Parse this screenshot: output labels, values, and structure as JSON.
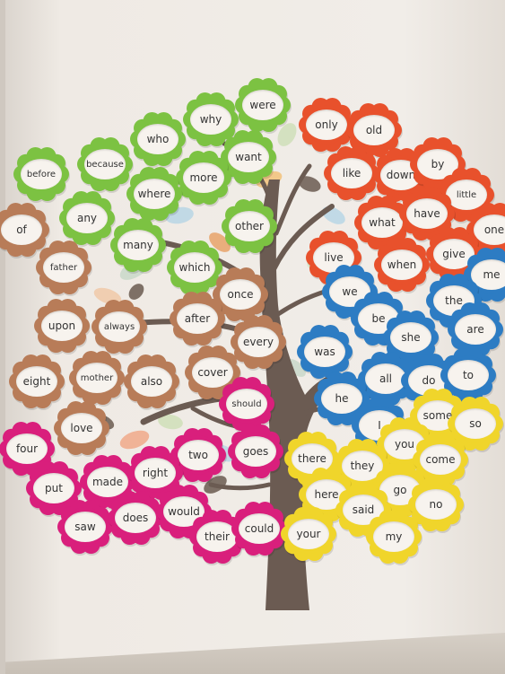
{
  "colors": {
    "green": "#7cc242",
    "orange": "#e8512c",
    "brown": "#b87c58",
    "blue": "#2d7cc3",
    "pink": "#d91f7c",
    "yellow": "#f0d52b",
    "trunk": "#6b5b52",
    "wall": "#ece7e1"
  },
  "flowers": [
    {
      "word": "were",
      "color": "green"
    },
    {
      "word": "why",
      "color": "green"
    },
    {
      "word": "who",
      "color": "green"
    },
    {
      "word": "because",
      "color": "green"
    },
    {
      "word": "before",
      "color": "green"
    },
    {
      "word": "want",
      "color": "green"
    },
    {
      "word": "more",
      "color": "green"
    },
    {
      "word": "where",
      "color": "green"
    },
    {
      "word": "any",
      "color": "green"
    },
    {
      "word": "other",
      "color": "green"
    },
    {
      "word": "many",
      "color": "green"
    },
    {
      "word": "which",
      "color": "green"
    },
    {
      "word": "only",
      "color": "orange"
    },
    {
      "word": "old",
      "color": "orange"
    },
    {
      "word": "like",
      "color": "orange"
    },
    {
      "word": "down",
      "color": "orange"
    },
    {
      "word": "by",
      "color": "orange"
    },
    {
      "word": "little",
      "color": "orange"
    },
    {
      "word": "what",
      "color": "orange"
    },
    {
      "word": "have",
      "color": "orange"
    },
    {
      "word": "one",
      "color": "orange"
    },
    {
      "word": "live",
      "color": "orange"
    },
    {
      "word": "when",
      "color": "orange"
    },
    {
      "word": "give",
      "color": "orange"
    },
    {
      "word": "of",
      "color": "brown"
    },
    {
      "word": "father",
      "color": "brown"
    },
    {
      "word": "once",
      "color": "brown"
    },
    {
      "word": "upon",
      "color": "brown"
    },
    {
      "word": "always",
      "color": "brown"
    },
    {
      "word": "after",
      "color": "brown"
    },
    {
      "word": "every",
      "color": "brown"
    },
    {
      "word": "eight",
      "color": "brown"
    },
    {
      "word": "mother",
      "color": "brown"
    },
    {
      "word": "also",
      "color": "brown"
    },
    {
      "word": "cover",
      "color": "brown"
    },
    {
      "word": "love",
      "color": "brown"
    },
    {
      "word": "me",
      "color": "blue"
    },
    {
      "word": "we",
      "color": "blue"
    },
    {
      "word": "the",
      "color": "blue"
    },
    {
      "word": "be",
      "color": "blue"
    },
    {
      "word": "are",
      "color": "blue"
    },
    {
      "word": "she",
      "color": "blue"
    },
    {
      "word": "was",
      "color": "blue"
    },
    {
      "word": "all",
      "color": "blue"
    },
    {
      "word": "do",
      "color": "blue"
    },
    {
      "word": "to",
      "color": "blue"
    },
    {
      "word": "he",
      "color": "blue"
    },
    {
      "word": "I",
      "color": "blue"
    },
    {
      "word": "should",
      "color": "pink"
    },
    {
      "word": "four",
      "color": "pink"
    },
    {
      "word": "two",
      "color": "pink"
    },
    {
      "word": "goes",
      "color": "pink"
    },
    {
      "word": "put",
      "color": "pink"
    },
    {
      "word": "made",
      "color": "pink"
    },
    {
      "word": "right",
      "color": "pink"
    },
    {
      "word": "saw",
      "color": "pink"
    },
    {
      "word": "does",
      "color": "pink"
    },
    {
      "word": "would",
      "color": "pink"
    },
    {
      "word": "their",
      "color": "pink"
    },
    {
      "word": "could",
      "color": "pink"
    },
    {
      "word": "some",
      "color": "yellow"
    },
    {
      "word": "so",
      "color": "yellow"
    },
    {
      "word": "you",
      "color": "yellow"
    },
    {
      "word": "there",
      "color": "yellow"
    },
    {
      "word": "they",
      "color": "yellow"
    },
    {
      "word": "come",
      "color": "yellow"
    },
    {
      "word": "here",
      "color": "yellow"
    },
    {
      "word": "go",
      "color": "yellow"
    },
    {
      "word": "said",
      "color": "yellow"
    },
    {
      "word": "no",
      "color": "yellow"
    },
    {
      "word": "your",
      "color": "yellow"
    },
    {
      "word": "my",
      "color": "yellow"
    }
  ]
}
